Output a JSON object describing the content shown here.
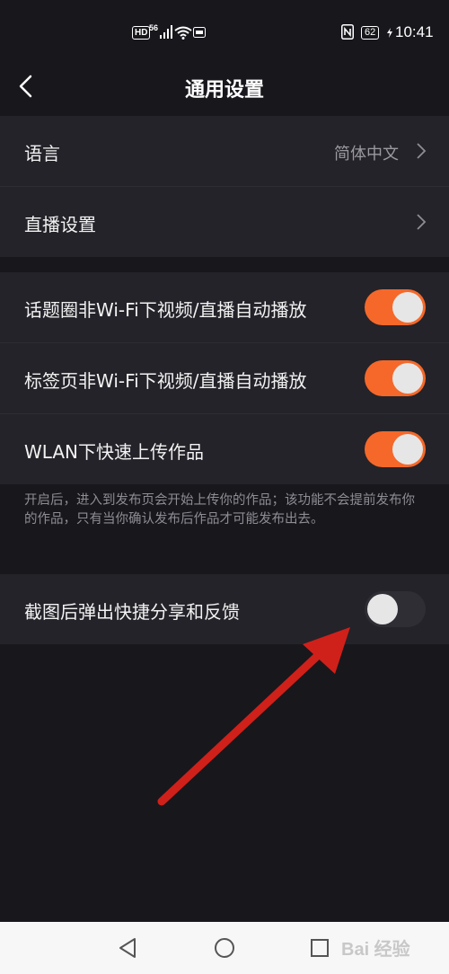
{
  "status_bar": {
    "hd": "HD",
    "network": "56",
    "battery": "62",
    "time": "10:41"
  },
  "header": {
    "title": "通用设置"
  },
  "section1": [
    {
      "label": "语言",
      "value": "简体中文"
    },
    {
      "label": "直播设置",
      "value": ""
    }
  ],
  "section2": [
    {
      "label": "话题圈非Wi-Fi下视频/直播自动播放",
      "toggle": true
    },
    {
      "label": "标签页非Wi-Fi下视频/直播自动播放",
      "toggle": true
    },
    {
      "label": "WLAN下快速上传作品",
      "toggle": true
    }
  ],
  "note": "开启后，进入到发布页会开始上传你的作品；该功能不会提前发布你的作品，只有当你确认发布后作品才可能发布出去。",
  "section3": [
    {
      "label": "截图后弹出快捷分享和反馈",
      "toggle": false
    }
  ],
  "colors": {
    "accent": "#f5682a",
    "background": "#18171c",
    "row": "#242329",
    "arrow": "#d0201a"
  },
  "nav": {
    "watermark": "Bai 经验"
  }
}
